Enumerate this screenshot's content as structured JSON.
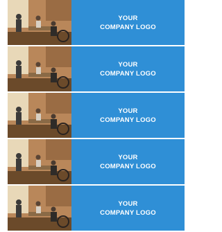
{
  "panel_color": "#2f8fd6",
  "photo_colors": {
    "wall": "#b9875a",
    "floor": "#6b4a2a",
    "window": "#e8d8b8",
    "figure": "#3c3b3a",
    "table": "#8a6a46"
  },
  "strips": [
    {
      "logo_line1": "YOUR",
      "logo_line2": "COMPANY LOGO",
      "photo": "office-meeting-photo"
    },
    {
      "logo_line1": "YOUR",
      "logo_line2": "COMPANY LOGO",
      "photo": "office-meeting-photo"
    },
    {
      "logo_line1": "YOUR",
      "logo_line2": "COMPANY LOGO",
      "photo": "office-meeting-photo"
    },
    {
      "logo_line1": "YOUR",
      "logo_line2": "COMPANY LOGO",
      "photo": "office-meeting-photo"
    },
    {
      "logo_line1": "YOUR",
      "logo_line2": "COMPANY LOGO",
      "photo": "office-meeting-photo"
    }
  ]
}
